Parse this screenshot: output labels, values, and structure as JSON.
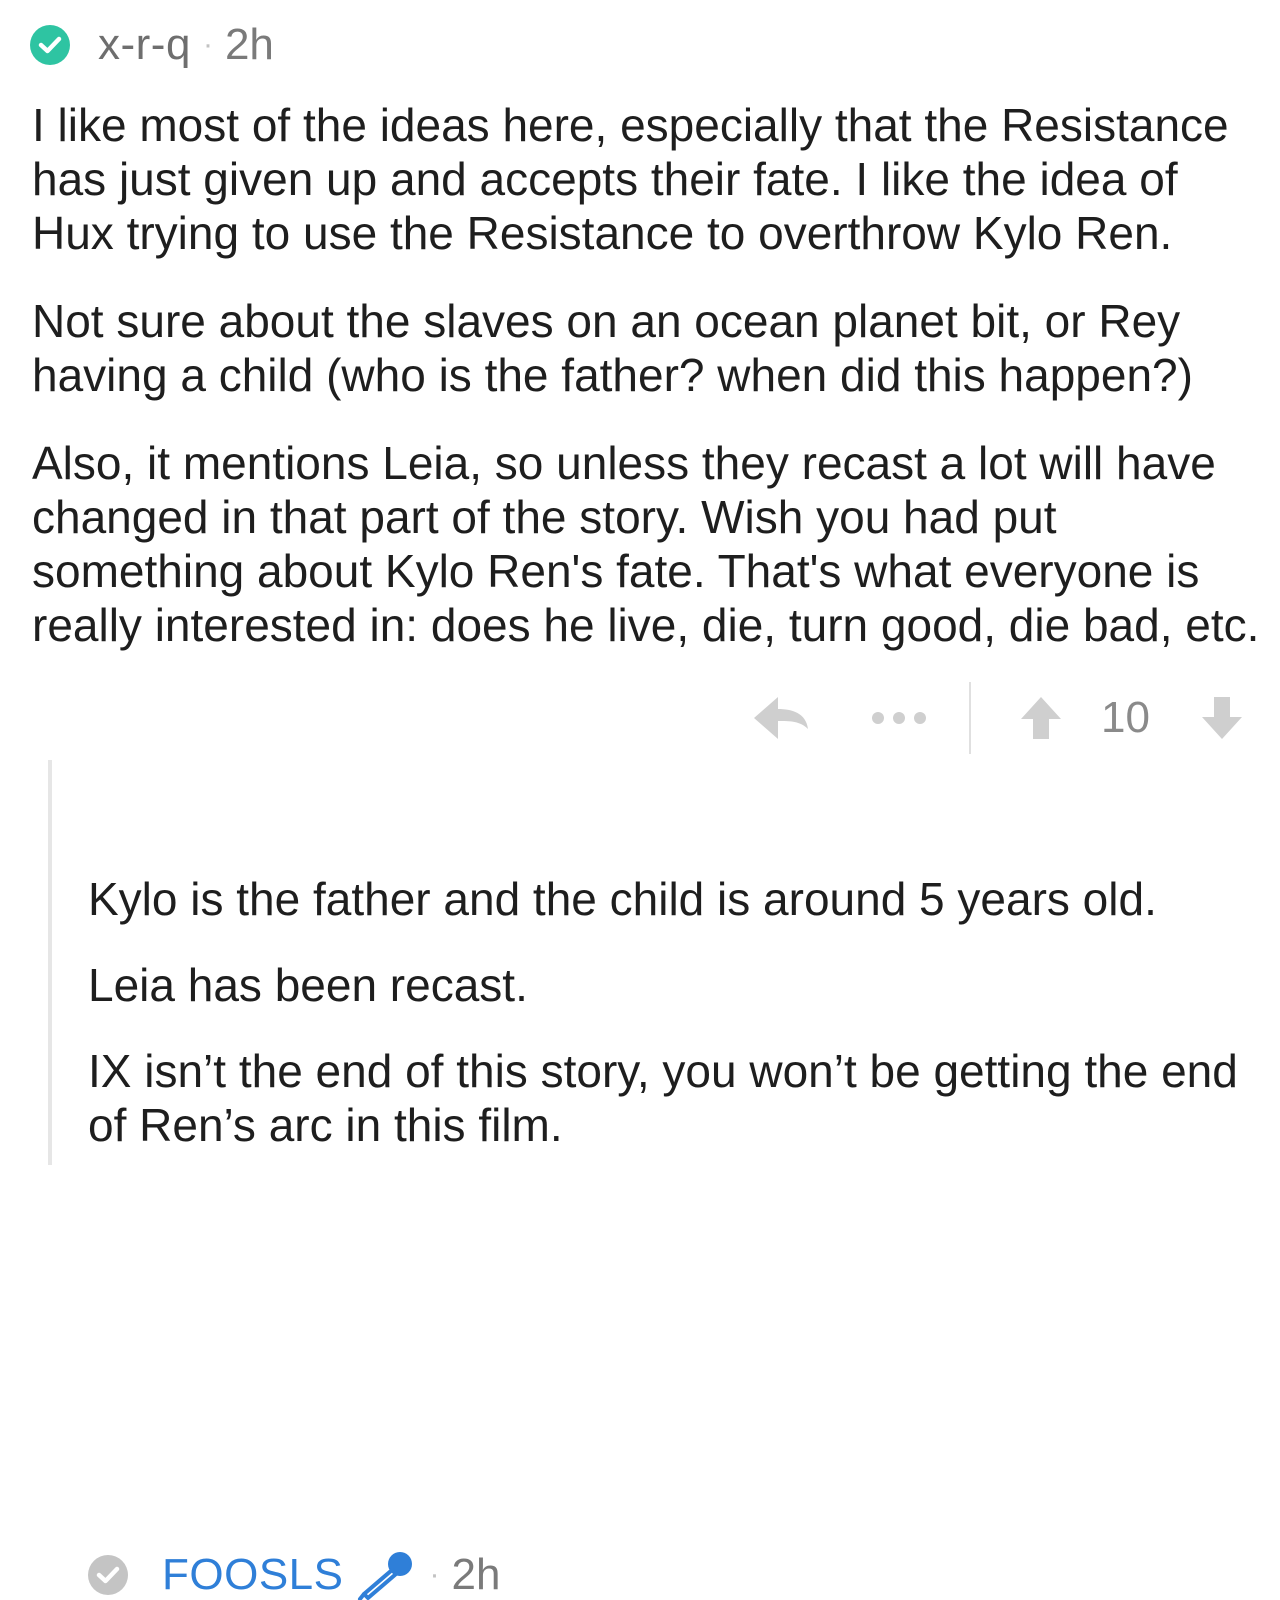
{
  "top_comment": {
    "username": "x-r-q",
    "separator": "·",
    "time": "2h",
    "badge_color": "#2ec4a2",
    "badge_icon": "check-icon",
    "paragraphs": [
      [
        "I like most of the ideas here, especially that the Resistance",
        "has just given up and accepts their fate. I like the idea of",
        "Hux trying to use the Resistance to overthrow Kylo Ren."
      ],
      [
        "Not sure about the slaves on an ocean planet bit, or Rey",
        "having a child (who is the father? when did this happen?)"
      ],
      [
        "Also, it mentions Leia, so unless they recast a lot will have",
        "changed in that part of the story. Wish you had put",
        "something about Kylo Ren's fate. That's what everyone is",
        "really interested in: does he live, die, turn good, die bad, etc."
      ]
    ],
    "actions": {
      "reply_icon": "reply-arrow-icon",
      "more_icon": "more-dots-icon",
      "upvote_icon": "upvote-arrow-icon",
      "downvote_icon": "downvote-arrow-icon",
      "score": "10"
    }
  },
  "reply_comment": {
    "username": "FOOSLS",
    "username_color": "#2f7fd8",
    "flair_icon": "microphone-icon",
    "separator": "·",
    "time": "2h",
    "badge_color": "#c4c4c4",
    "badge_icon": "check-icon",
    "paragraphs": [
      [
        "Kylo is the father and the child is around 5 years old."
      ],
      [
        "Leia has been recast."
      ],
      [
        "IX isn’t the end of this story, you won’t be getting the end",
        "of Ren’s arc in this film."
      ]
    ]
  },
  "colors": {
    "icon_gray": "#cfcfcf",
    "text": "#1e1e1e",
    "meta_gray": "#6e6e6e",
    "divider": "#e0e0e0",
    "thread_line": "#e6e6e6"
  }
}
